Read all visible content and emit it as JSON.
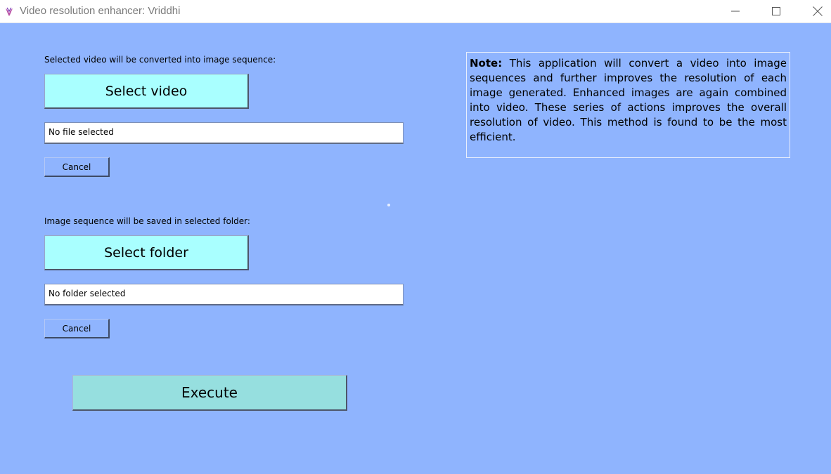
{
  "window": {
    "title": "Video resolution enhancer: Vriddhi",
    "icon": "vriddhi-app-icon",
    "controls": {
      "minimize_icon": "minimize-icon",
      "maximize_icon": "maximize-icon",
      "close_icon": "close-icon"
    }
  },
  "video_section": {
    "label": "Selected video will be converted into image sequence:",
    "select_button": "Select video",
    "path_value": "No file selected",
    "cancel_button": "Cancel"
  },
  "folder_section": {
    "label": "Image sequence will be saved in selected folder:",
    "select_button": "Select folder",
    "path_value": "No folder selected",
    "cancel_button": "Cancel"
  },
  "execute_button": "Execute",
  "note": {
    "heading": "Note:",
    "body": "This application will convert a video into image sequences and further improves the resolution of each image generated. Enhanced images are again combined into video. These series of actions improves the overall resolution of video. This method is found to be the most efficient."
  },
  "colors": {
    "background": "#8fb4fe",
    "select_button": "#a9ffff",
    "execute_button": "#96dfdf",
    "titlebar": "#ffffff"
  }
}
